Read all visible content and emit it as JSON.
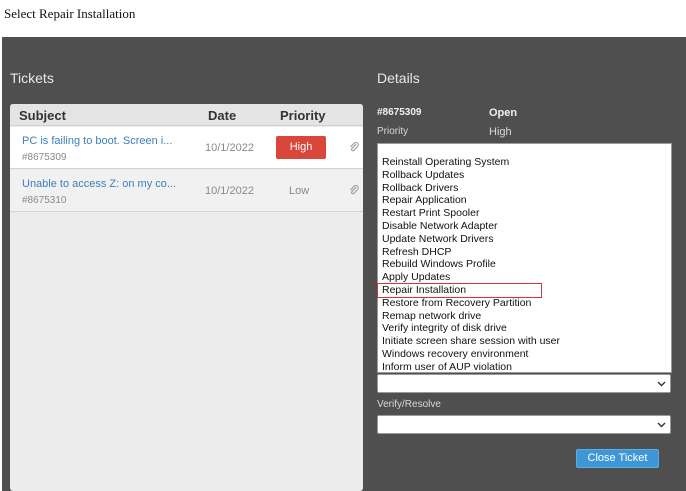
{
  "caption": "Select Repair Installation",
  "tickets": {
    "title": "Tickets",
    "columns": {
      "subject": "Subject",
      "date": "Date",
      "priority": "Priority"
    },
    "rows": [
      {
        "subject": "PC is failing to boot. Screen i...",
        "id": "#8675309",
        "date": "10/1/2022",
        "priority": "High",
        "attachment_icon": "paperclip-icon"
      },
      {
        "subject": "Unable to access Z: on my co...",
        "id": "#8675310",
        "date": "10/1/2022",
        "priority": "Low",
        "attachment_icon": "paperclip-icon"
      }
    ]
  },
  "details": {
    "title": "Details",
    "ticket_id": "#8675309",
    "status": "Open",
    "priority_label": "Priority",
    "priority_value": "High",
    "actions": [
      "Reinstall Operating System",
      "Rollback Updates",
      "Rollback Drivers",
      "Repair Application",
      "Restart Print Spooler",
      "Disable Network Adapter",
      "Update Network Drivers",
      "Refresh DHCP",
      "Rebuild Windows Profile",
      "Apply Updates",
      "Repair Installation",
      "Restore from Recovery Partition",
      "Remap network drive",
      "Verify integrity of disk drive",
      "Initiate screen share session with user",
      "Windows recovery environment",
      "Inform user of AUP violation"
    ],
    "highlighted_action": "Repair Installation",
    "action_select_value": "",
    "verify_label": "Verify/Resolve",
    "verify_select_value": "",
    "close_button": "Close Ticket"
  },
  "colors": {
    "app_background": "#4f4f4f",
    "high_priority": "#d9473b",
    "link": "#3a7fc1",
    "highlight_outline": "#d8363a",
    "button": "#3d97d6"
  }
}
